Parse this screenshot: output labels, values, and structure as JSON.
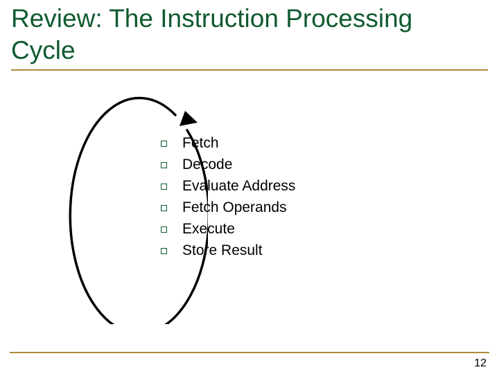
{
  "title": "Review: The Instruction Processing Cycle",
  "items": [
    {
      "label": "Fetch"
    },
    {
      "label": "Decode"
    },
    {
      "label": "Evaluate Address"
    },
    {
      "label": "Fetch Operands"
    },
    {
      "label": "Execute"
    },
    {
      "label": "Store Result"
    }
  ],
  "page_number": "12"
}
